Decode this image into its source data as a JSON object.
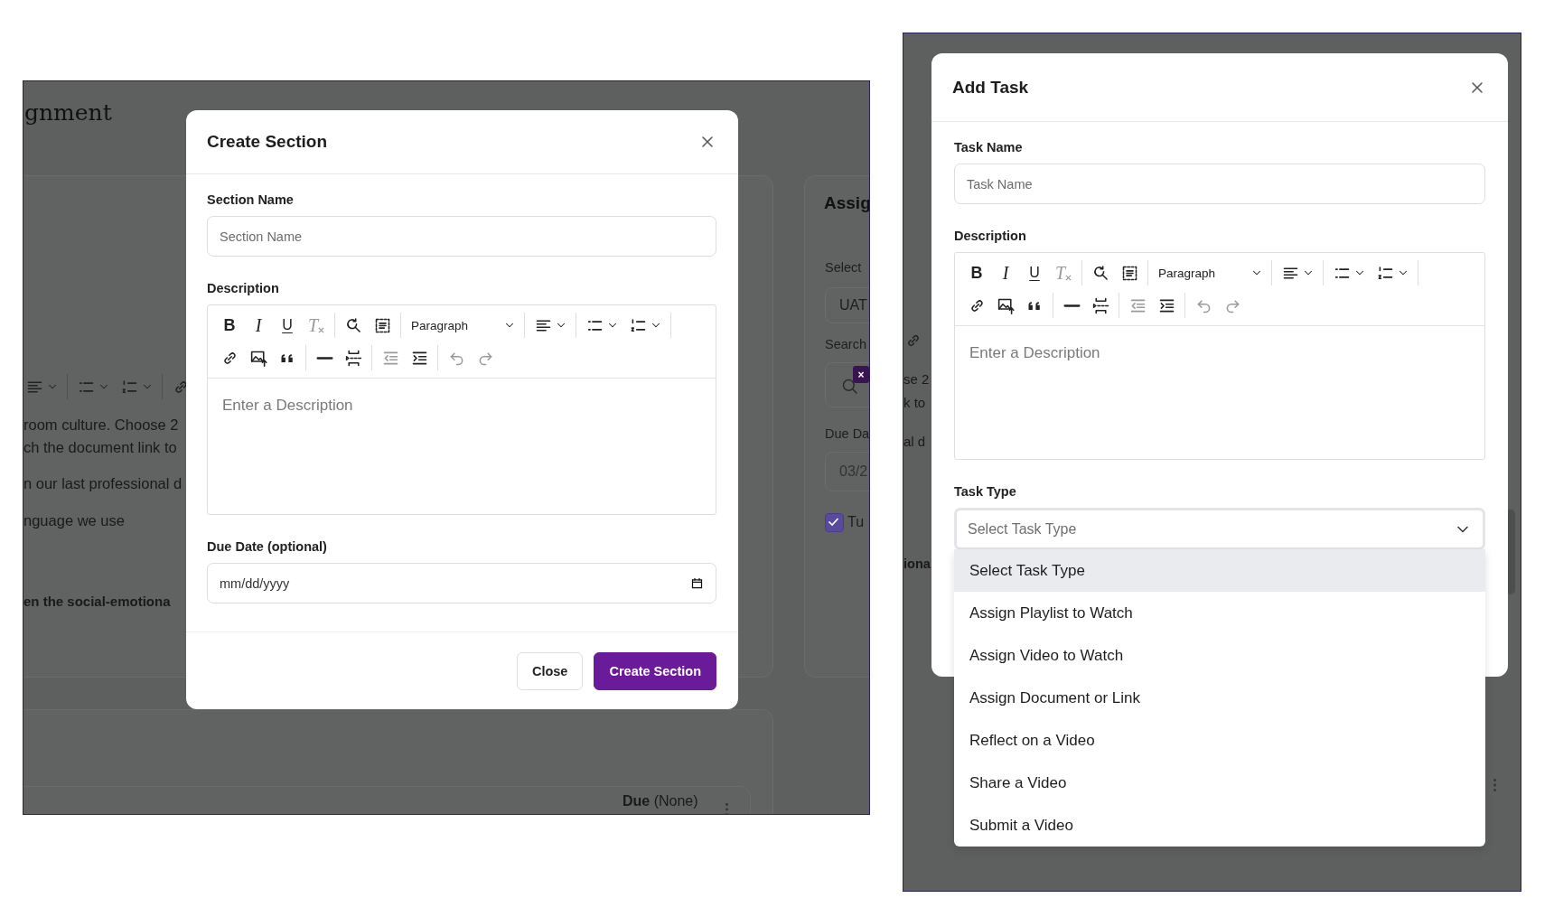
{
  "left_screen": {
    "background": {
      "page_title": "gnment",
      "toolbar": [
        [
          [
            {
              "kind": "align",
              "disabled": false
            }
          ],
          [
            {
              "kind": "bullet-list",
              "disabled": false
            },
            {
              "kind": "numbered-list",
              "disabled": false
            }
          ],
          [
            {
              "kind": "link",
              "disabled": false
            }
          ]
        ]
      ],
      "text_lines": [
        "room culture. Choose 2",
        "ch the document link to",
        "n our last professional d",
        "nguage we use"
      ],
      "bold_line": "en the social-emotiona",
      "side_card": {
        "title": "Assig",
        "select_label": "Select",
        "select_value": "UAT",
        "search_label": "Search",
        "tag_mark": "×",
        "due_label": "Due Da",
        "due_value": "03/2",
        "checkbox_label": "Tu",
        "checked": true
      },
      "due_text": "**Due** (None)"
    },
    "modal": {
      "title": "Create Section",
      "name_label": "Section Name",
      "name_placeholder": "Section Name",
      "description_label": "Description",
      "editor": {
        "toolbar": [
          [
            [
              {
                "kind": "bold",
                "label": "B",
                "disabled": false
              },
              {
                "kind": "italic",
                "label": "I",
                "disabled": false
              },
              {
                "kind": "underline",
                "label": "U",
                "disabled": false
              },
              {
                "kind": "clear-format",
                "label": "T",
                "disabled": true
              }
            ],
            [
              {
                "kind": "find-replace",
                "disabled": false
              },
              {
                "kind": "select-all",
                "disabled": false
              }
            ],
            [
              {
                "kind": "block-format",
                "label": "Paragraph",
                "disabled": false
              }
            ],
            [
              {
                "kind": "align",
                "disabled": false
              }
            ],
            [
              {
                "kind": "bullet-list",
                "disabled": false
              },
              {
                "kind": "numbered-list",
                "disabled": false
              }
            ]
          ],
          [
            [
              {
                "kind": "link",
                "disabled": false
              },
              {
                "kind": "image",
                "disabled": false
              },
              {
                "kind": "quote",
                "disabled": false
              }
            ],
            [
              {
                "kind": "horizontal-rule",
                "disabled": false
              },
              {
                "kind": "page-break",
                "disabled": false
              }
            ],
            [
              {
                "kind": "outdent",
                "disabled": true
              },
              {
                "kind": "indent",
                "disabled": false
              }
            ],
            [
              {
                "kind": "undo",
                "disabled": true
              },
              {
                "kind": "redo",
                "disabled": true
              }
            ]
          ]
        ],
        "placeholder": "Enter a Description"
      },
      "due_label": "Due Date (optional)",
      "due_placeholder": "mm/dd/yyyy",
      "buttons": [
        {
          "label": "Close",
          "kind": "secondary"
        },
        {
          "label": "Create Section",
          "kind": "primary"
        }
      ]
    }
  },
  "right_screen": {
    "background": {
      "text_lines": [
        "se 2",
        "k to",
        "al d"
      ],
      "bold_line": "iona"
    },
    "modal": {
      "title": "Add Task",
      "name_label": "Task Name",
      "name_placeholder": "Task Name",
      "description_label": "Description",
      "editor": {
        "toolbar": [
          [
            [
              {
                "kind": "bold",
                "label": "B",
                "disabled": false
              },
              {
                "kind": "italic",
                "label": "I",
                "disabled": false
              },
              {
                "kind": "underline",
                "label": "U",
                "disabled": false
              },
              {
                "kind": "clear-format",
                "label": "T",
                "disabled": true
              }
            ],
            [
              {
                "kind": "find-replace",
                "disabled": false
              },
              {
                "kind": "select-all",
                "disabled": false
              }
            ],
            [
              {
                "kind": "block-format",
                "label": "Paragraph",
                "disabled": false
              }
            ],
            [
              {
                "kind": "align",
                "disabled": false
              }
            ],
            [
              {
                "kind": "bullet-list",
                "disabled": false
              },
              {
                "kind": "numbered-list",
                "disabled": false
              }
            ]
          ],
          [
            [
              {
                "kind": "link",
                "disabled": false
              },
              {
                "kind": "image",
                "disabled": false
              },
              {
                "kind": "quote",
                "disabled": false
              }
            ],
            [
              {
                "kind": "horizontal-rule",
                "disabled": false
              },
              {
                "kind": "page-break",
                "disabled": false
              }
            ],
            [
              {
                "kind": "outdent",
                "disabled": true
              },
              {
                "kind": "indent",
                "disabled": false
              }
            ],
            [
              {
                "kind": "undo",
                "disabled": true
              },
              {
                "kind": "redo",
                "disabled": true
              }
            ]
          ]
        ],
        "placeholder": "Enter a Description"
      },
      "type_label": "Task Type",
      "type_placeholder": "Select Task Type",
      "options": [
        {
          "label": "Select Task Type",
          "selected": true
        },
        {
          "label": "Assign Playlist to Watch",
          "selected": false
        },
        {
          "label": "Assign Video to Watch",
          "selected": false
        },
        {
          "label": "Assign Document or Link",
          "selected": false
        },
        {
          "label": "Reflect on a Video",
          "selected": false
        },
        {
          "label": "Share a Video",
          "selected": false
        },
        {
          "label": "Submit a Video",
          "selected": false
        }
      ]
    }
  }
}
